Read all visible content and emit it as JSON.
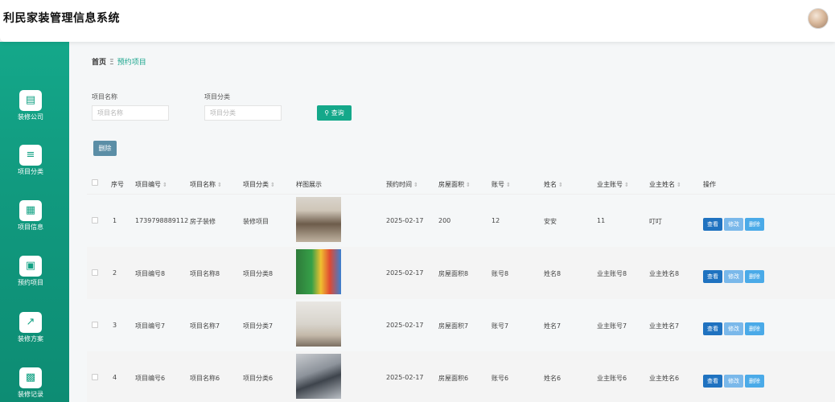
{
  "app": {
    "title": "利民家装管理信息系统"
  },
  "sidebar": {
    "items": [
      {
        "label": "装修公司",
        "icon": "chat-icon"
      },
      {
        "label": "项目分类",
        "icon": "list-icon"
      },
      {
        "label": "项目信息",
        "icon": "grid-icon"
      },
      {
        "label": "预约项目",
        "icon": "briefcase-icon"
      },
      {
        "label": "装修方案",
        "icon": "chart-icon"
      },
      {
        "label": "装修记录",
        "icon": "monitor-icon"
      }
    ]
  },
  "breadcrumb": {
    "home": "首页",
    "separator": "Ξ",
    "current": "预约项目"
  },
  "search": {
    "name_label": "项目名称",
    "name_placeholder": "项目名称",
    "category_label": "项目分类",
    "category_placeholder": "项目分类",
    "search_button": "查询"
  },
  "toolbar": {
    "delete_button": "删除"
  },
  "table": {
    "columns": [
      "序号",
      "项目编号",
      "项目名称",
      "项目分类",
      "样图展示",
      "预约时间",
      "房屋面积",
      "账号",
      "姓名",
      "业主账号",
      "业主姓名",
      "操作"
    ],
    "actions": {
      "view": "查看",
      "edit": "修改",
      "delete": "删除"
    },
    "rows": [
      {
        "index": "1",
        "code": "1739798889112",
        "name": "房子装修",
        "category": "装修项目",
        "date": "2025-02-17",
        "area": "200",
        "account": "12",
        "person": "安安",
        "owner_account": "11",
        "owner_name": "叮叮"
      },
      {
        "index": "2",
        "code": "项目编号8",
        "name": "项目名称8",
        "category": "项目分类8",
        "date": "2025-02-17",
        "area": "房屋面积8",
        "account": "账号8",
        "person": "姓名8",
        "owner_account": "业主账号8",
        "owner_name": "业主姓名8"
      },
      {
        "index": "3",
        "code": "项目编号7",
        "name": "项目名称7",
        "category": "项目分类7",
        "date": "2025-02-17",
        "area": "房屋面积7",
        "account": "账号7",
        "person": "姓名7",
        "owner_account": "业主账号7",
        "owner_name": "业主姓名7"
      },
      {
        "index": "4",
        "code": "项目编号6",
        "name": "项目名称6",
        "category": "项目分类6",
        "date": "2025-02-17",
        "area": "房屋面积6",
        "account": "账号6",
        "person": "姓名6",
        "owner_account": "业主账号6",
        "owner_name": "业主姓名6"
      }
    ]
  }
}
